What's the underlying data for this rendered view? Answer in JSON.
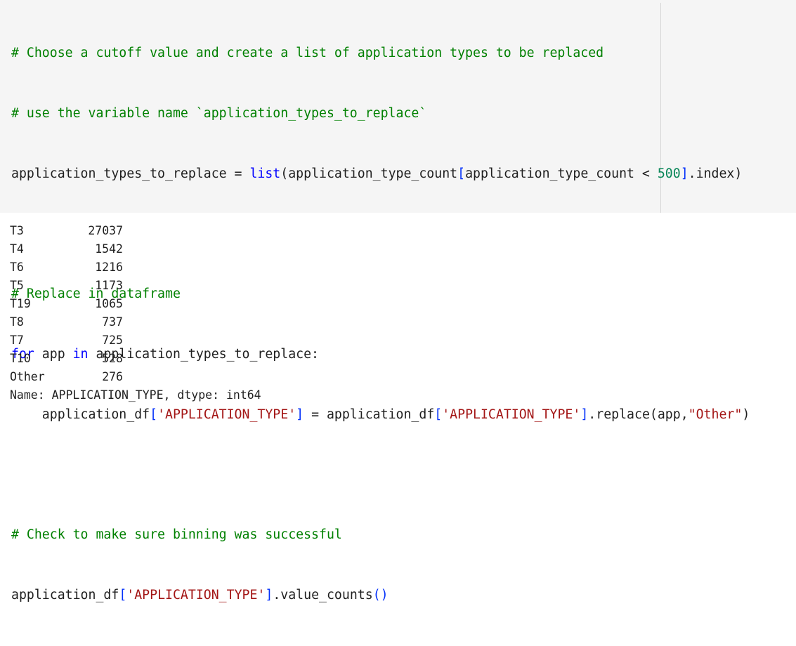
{
  "input_cell": {
    "lines": {
      "l1": "# Choose a cutoff value and create a list of application types to be replaced",
      "l2": "# use the variable name `application_types_to_replace`",
      "l3": {
        "a": "application_types_to_replace = ",
        "b": "list",
        "c": "(application_type_count",
        "d": "[",
        "e": "application_type_count < ",
        "f": "500",
        "g": "]",
        "h": ".index)"
      },
      "l5": "# Replace in dataframe",
      "l6": {
        "a": "for",
        "b": " app ",
        "c": "in",
        "d": " application_types_to_replace:"
      },
      "l7": {
        "a": "    application_df",
        "b": "[",
        "c": "'APPLICATION_TYPE'",
        "d": "]",
        "e": " = application_df",
        "f": "[",
        "g": "'APPLICATION_TYPE'",
        "h": "]",
        "i": ".replace(app,",
        "j": "\"Other\"",
        "k": ")"
      },
      "l9": "# Check to make sure binning was successful",
      "l10": {
        "a": "application_df",
        "b": "[",
        "c": "'APPLICATION_TYPE'",
        "d": "]",
        "e": ".value_counts",
        "f": "()"
      }
    }
  },
  "output_cell": {
    "rows": [
      {
        "label": "T3",
        "count": "27037"
      },
      {
        "label": "T4",
        "count": "1542"
      },
      {
        "label": "T6",
        "count": "1216"
      },
      {
        "label": "T5",
        "count": "1173"
      },
      {
        "label": "T19",
        "count": "1065"
      },
      {
        "label": "T8",
        "count": "737"
      },
      {
        "label": "T7",
        "count": "725"
      },
      {
        "label": "T10",
        "count": "528"
      },
      {
        "label": "Other",
        "count": "276"
      }
    ],
    "footer": "Name: APPLICATION_TYPE, dtype: int64"
  },
  "colors": {
    "comment": "#008000",
    "keyword": "#0000ff",
    "string": "#a31515",
    "number": "#098658",
    "bracket": "#0431fa",
    "input_background": "#f5f5f5"
  }
}
